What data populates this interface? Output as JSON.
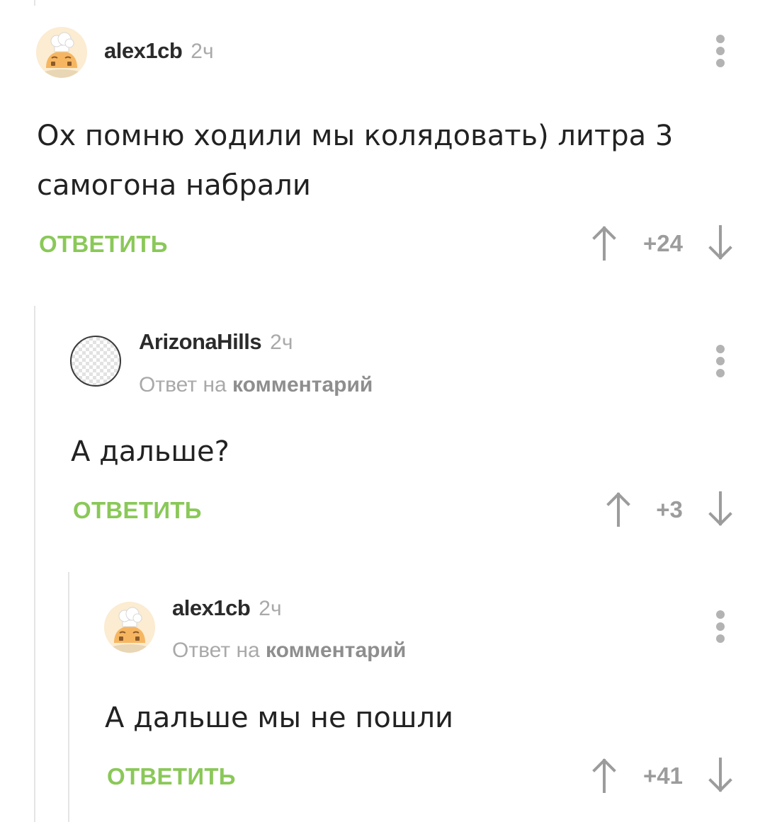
{
  "comments": [
    {
      "username": "alex1cb",
      "time": "2ч",
      "reply_to": null,
      "text": "Ох помню ходили мы колядовать) литра 3 самогона набрали",
      "reply_label": "ОТВЕТИТЬ",
      "rating": "+24"
    },
    {
      "username": "ArizonaHills",
      "time": "2ч",
      "reply_to": {
        "prefix": "Ответ на",
        "link": "комментарий"
      },
      "text": "А дальше?",
      "reply_label": "ОТВЕТИТЬ",
      "rating": "+3"
    },
    {
      "username": "alex1cb",
      "time": "2ч",
      "reply_to": {
        "prefix": "Ответ на",
        "link": "комментарий"
      },
      "text": "А дальше мы не пошли",
      "reply_label": "ОТВЕТИТЬ",
      "rating": "+41"
    }
  ],
  "colors": {
    "reply_button": "#8ac858",
    "rating": "#9c9c9c",
    "meta": "#a9a9a9",
    "thread_line": "#e4e4e4"
  },
  "icons": {
    "avatar_alex": "pikabu-chef-avatar-icon",
    "avatar_arizona": "default-avatar-icon",
    "more": "more-vertical-icon",
    "vote_up": "arrow-up-icon",
    "vote_down": "arrow-down-icon"
  }
}
